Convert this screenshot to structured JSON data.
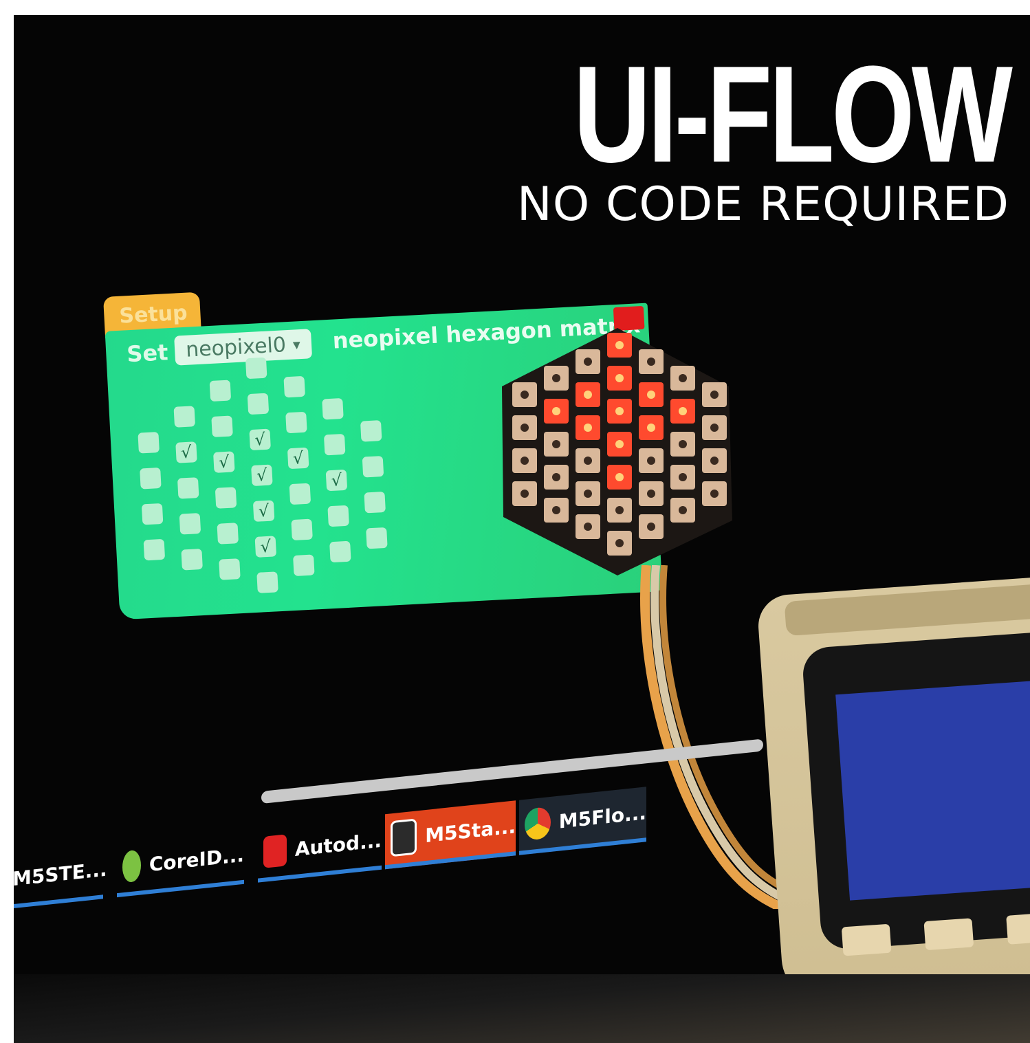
{
  "headline": {
    "title": "UI-FLOW",
    "subtitle": "NO CODE REQUIRED"
  },
  "block": {
    "tab_label": "Setup",
    "set_label": "Set",
    "dropdown_value": "neopixel0",
    "description": "neopixel hexagon matrix",
    "color_swatch": "#e11d1d",
    "check_glyph": "√",
    "grid_checked": [
      [
        false,
        false,
        false,
        false,
        false,
        false,
        false
      ],
      [
        false,
        true,
        false,
        false,
        false,
        false,
        false
      ],
      [
        false,
        false,
        true,
        true,
        true,
        true,
        false
      ],
      [
        false,
        false,
        false,
        true,
        false,
        false,
        false
      ],
      [
        false,
        false,
        false,
        true,
        false,
        false,
        false
      ],
      [
        false,
        false,
        false,
        true,
        false,
        false,
        false
      ],
      [
        false,
        false,
        false,
        false,
        false,
        false,
        false
      ]
    ]
  },
  "taskbar": {
    "items": [
      {
        "label": "M5STE...",
        "icon": "m5stack-app-icon",
        "active": false
      },
      {
        "label": "CoreID...",
        "icon": "coreldraw-icon",
        "active": false
      },
      {
        "label": "Autod...",
        "icon": "autodesk-icon",
        "active": false
      },
      {
        "label": "M5Sta...",
        "icon": "m5stack-burner-icon",
        "active": true
      },
      {
        "label": "M5Flo...",
        "icon": "chrome-icon",
        "active": false
      }
    ]
  },
  "colors": {
    "block_green": "#23e28e",
    "tab_orange": "#f5b538",
    "led_red": "#ff4a2e",
    "device_screen": "#2a3ea8"
  }
}
